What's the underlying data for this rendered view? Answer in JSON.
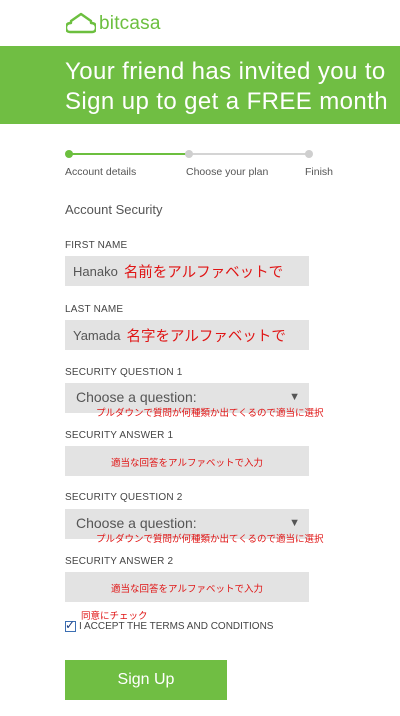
{
  "brand": {
    "name": "bitcasa",
    "color": "#6cbf3f",
    "logo_icon": "cloud-house-icon"
  },
  "banner": {
    "line1": "Your friend has invited you to",
    "line2": "Sign up to get a FREE month",
    "color": "#70be43"
  },
  "steps": {
    "items": [
      "Account details",
      "Choose your plan",
      "Finish"
    ],
    "current": 1,
    "progress_fraction": 0.5
  },
  "form": {
    "section_title": "Account Security",
    "first_name": {
      "label": "FIRST NAME",
      "value": "Hanako",
      "note": "名前をアルファベットで"
    },
    "last_name": {
      "label": "LAST NAME",
      "value": "Yamada",
      "note": "名字をアルファベットで"
    },
    "question1": {
      "label": "SECURITY QUESTION 1",
      "placeholder": "Choose a question:",
      "note": "プルダウンで質問が何種類か出てくるので適当に選択"
    },
    "answer1": {
      "label": "SECURITY ANSWER 1",
      "note": "適当な回答をアルファベットで入力"
    },
    "question2": {
      "label": "SECURITY QUESTION 2",
      "placeholder": "Choose a question:",
      "note": "プルダウンで質問が何種類か出てくるので適当に選択"
    },
    "answer2": {
      "label": "SECURITY ANSWER 2",
      "note": "適当な回答をアルファベットで入力"
    },
    "terms": {
      "note": "同意にチェック",
      "label": "I ACCEPT THE TERMS AND CONDITIONS",
      "checked": true
    },
    "submit_label": "Sign Up"
  },
  "colors": {
    "annotation": "#e01515",
    "field_bg": "#e3e3e3"
  }
}
